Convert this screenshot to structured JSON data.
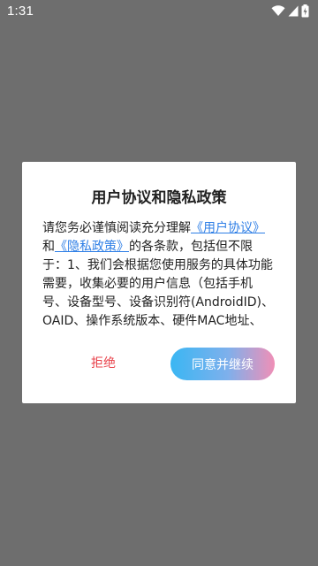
{
  "status_bar": {
    "time": "1:31",
    "icons": [
      "wifi-icon",
      "cell-signal-icon",
      "battery-icon"
    ]
  },
  "dialog": {
    "title": "用户协议和隐私政策",
    "body": {
      "intro": "请您务必谨慎阅读充分理解",
      "link_user_agreement": "《用户协议》",
      "and": "和",
      "link_privacy_policy": "《隐私政策》",
      "rest": "的各条款，包括但不限于：1、我们会根据您使用服务的具体功能需要，收集必要的用户信息（包括手机号、设备型号、设备识别符(AndroidID)、OAID、操作系统版本、硬件MAC地址、地"
    },
    "reject_label": "拒绝",
    "agree_label": "同意并继续"
  },
  "colors": {
    "backdrop": "#6e6e6e",
    "link": "#2f7fe6",
    "reject": "#e8414a",
    "agree_gradient_start": "#3ab6f3",
    "agree_gradient_end": "#f08fb6"
  }
}
